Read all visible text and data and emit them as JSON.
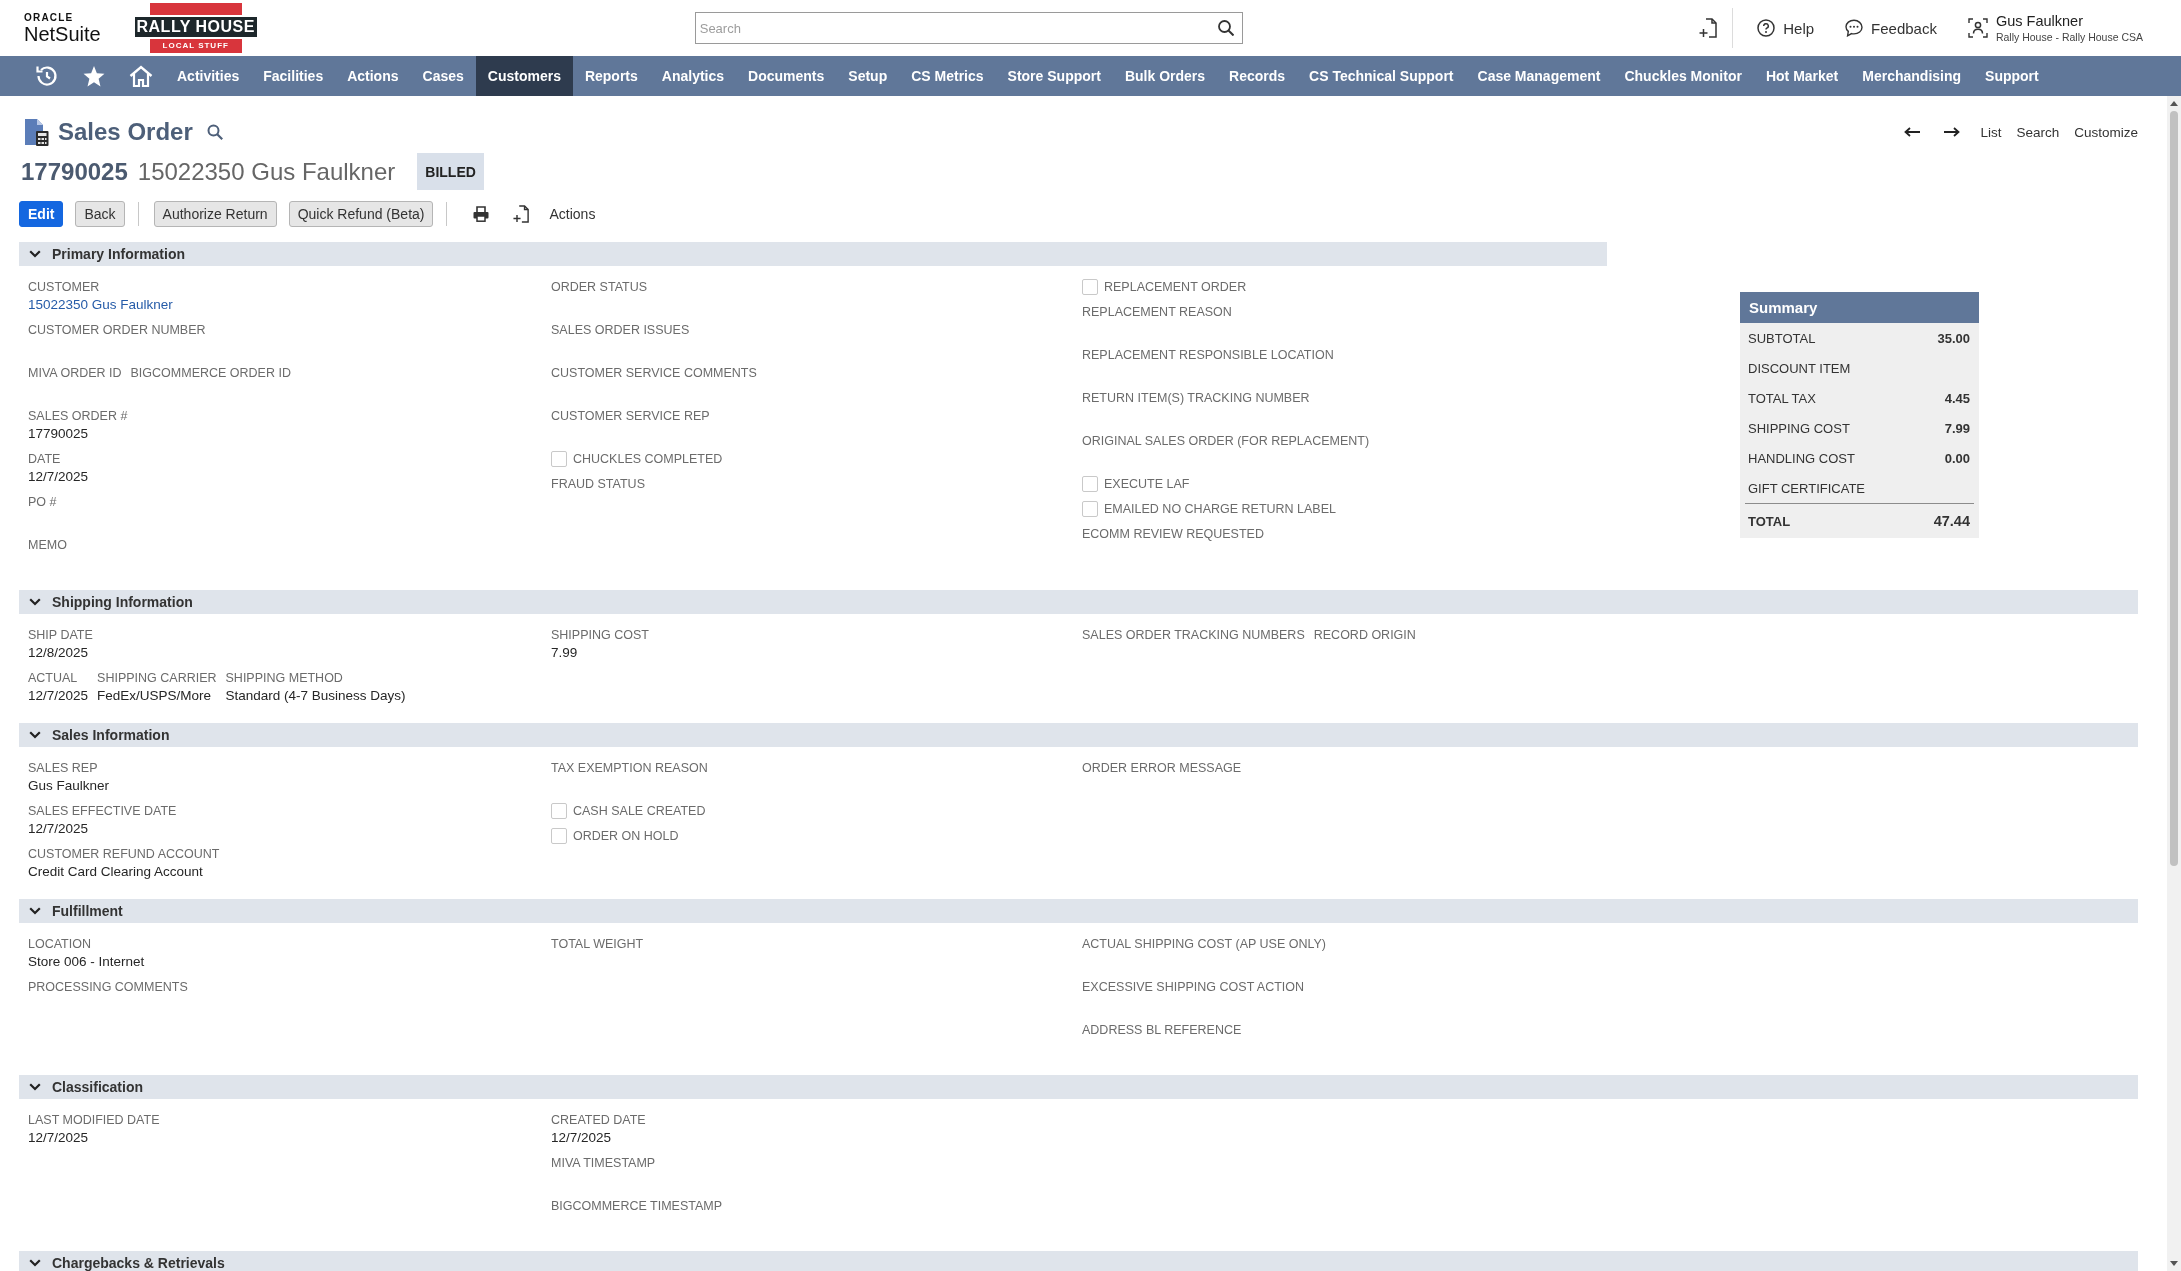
{
  "header": {
    "brand": {
      "vendor": "ORACLE",
      "product": "NetSuite"
    },
    "company_logo": {
      "wordmark": "RALLY HOUSE",
      "tagline": "LOCAL STUFF"
    },
    "search": {
      "placeholder": "Search"
    },
    "links": [
      {
        "kind": "help",
        "label": "Help"
      },
      {
        "kind": "feedback",
        "label": "Feedback"
      }
    ],
    "user": {
      "name": "Gus Faulkner",
      "role": "Rally House - Rally House CSA"
    }
  },
  "nav": {
    "items": [
      {
        "label": "Activities",
        "selected": false
      },
      {
        "label": "Facilities",
        "selected": false
      },
      {
        "label": "Actions",
        "selected": false
      },
      {
        "label": "Cases",
        "selected": false
      },
      {
        "label": "Customers",
        "selected": true
      },
      {
        "label": "Reports",
        "selected": false
      },
      {
        "label": "Analytics",
        "selected": false
      },
      {
        "label": "Documents",
        "selected": false
      },
      {
        "label": "Setup",
        "selected": false
      },
      {
        "label": "CS Metrics",
        "selected": false
      },
      {
        "label": "Store Support",
        "selected": false
      },
      {
        "label": "Bulk Orders",
        "selected": false
      },
      {
        "label": "Records",
        "selected": false
      },
      {
        "label": "CS Technical Support",
        "selected": false
      },
      {
        "label": "Case Management",
        "selected": false
      },
      {
        "label": "Chuckles Monitor",
        "selected": false
      },
      {
        "label": "Hot Market",
        "selected": false
      },
      {
        "label": "Merchandising",
        "selected": false
      },
      {
        "label": "Support",
        "selected": false
      }
    ]
  },
  "record": {
    "type": "Sales Order",
    "number": "17790025",
    "name": "15022350 Gus Faulkner",
    "status": "BILLED"
  },
  "record_nav": {
    "links": [
      "List",
      "Search",
      "Customize"
    ]
  },
  "toolbar": {
    "button_groups": [
      [
        {
          "label": "Edit",
          "primary": true
        },
        {
          "label": "Back",
          "primary": false
        }
      ],
      [
        {
          "label": "Authorize Return",
          "primary": false
        },
        {
          "label": "Quick Refund (Beta)",
          "primary": false
        }
      ]
    ],
    "actions_label": "Actions"
  },
  "sections": [
    {
      "title": "Primary Information",
      "expanded": true,
      "columns": [
        [
          {
            "kind": "link",
            "label": "CUSTOMER",
            "value": "15022350 Gus Faulkner"
          },
          {
            "kind": "field",
            "label": "CUSTOMER ORDER NUMBER"
          },
          {
            "kind": "group",
            "fields": [
              {
                "label": "MIVA ORDER ID"
              },
              {
                "label": "BIGCOMMERCE ORDER ID"
              }
            ]
          },
          {
            "kind": "field",
            "label": "SALES ORDER #",
            "value": "17790025"
          },
          {
            "kind": "field",
            "label": "DATE",
            "value": "12/7/2025"
          },
          {
            "kind": "field",
            "label": "PO #"
          },
          {
            "kind": "field",
            "label": "MEMO"
          }
        ],
        [
          {
            "kind": "field",
            "label": "ORDER STATUS"
          },
          {
            "kind": "field",
            "label": "SALES ORDER ISSUES"
          },
          {
            "kind": "field",
            "label": "CUSTOMER SERVICE COMMENTS"
          },
          {
            "kind": "field",
            "label": "CUSTOMER SERVICE REP"
          },
          {
            "kind": "checkbox",
            "label": "CHUCKLES COMPLETED",
            "checked": false
          },
          {
            "kind": "field",
            "label": "FRAUD STATUS"
          }
        ],
        [
          {
            "kind": "checkbox",
            "label": "REPLACEMENT ORDER",
            "checked": false
          },
          {
            "kind": "field",
            "label": "REPLACEMENT REASON"
          },
          {
            "kind": "field",
            "label": "REPLACEMENT RESPONSIBLE LOCATION"
          },
          {
            "kind": "field",
            "label": "RETURN ITEM(S) TRACKING NUMBER"
          },
          {
            "kind": "field",
            "label": "ORIGINAL SALES ORDER (FOR REPLACEMENT)"
          },
          {
            "kind": "checkbox",
            "label": "EXECUTE LAF",
            "checked": false
          },
          {
            "kind": "checkbox",
            "label": "EMAILED NO CHARGE RETURN LABEL",
            "checked": false
          },
          {
            "kind": "field",
            "label": "ECOMM REVIEW REQUESTED"
          }
        ]
      ],
      "summary": {
        "title": "Summary",
        "rows": [
          {
            "label": "SUBTOTAL",
            "value": "35.00"
          },
          {
            "label": "DISCOUNT ITEM"
          },
          {
            "label": "TOTAL TAX",
            "value": "4.45"
          },
          {
            "label": "SHIPPING COST",
            "value": "7.99"
          },
          {
            "label": "HANDLING COST",
            "value": "0.00"
          },
          {
            "label": "GIFT CERTIFICATE"
          }
        ],
        "total": {
          "label": "TOTAL",
          "value": "47.44"
        }
      }
    },
    {
      "title": "Shipping Information",
      "expanded": true,
      "columns": [
        [
          {
            "kind": "field",
            "label": "SHIP DATE",
            "value": "12/8/2025"
          },
          {
            "kind": "group",
            "fields": [
              {
                "label": "ACTUAL",
                "value": "12/7/2025"
              },
              {
                "label": "SHIPPING CARRIER",
                "value": "FedEx/USPS/More"
              },
              {
                "label": "SHIPPING METHOD",
                "value": "Standard (4-7 Business Days)"
              }
            ]
          }
        ],
        [
          {
            "kind": "field",
            "label": "SHIPPING COST",
            "value": "7.99"
          }
        ],
        [
          {
            "kind": "group",
            "fields": [
              {
                "label": "SALES ORDER TRACKING NUMBERS"
              },
              {
                "label": "RECORD ORIGIN"
              }
            ]
          }
        ]
      ]
    },
    {
      "title": "Sales Information",
      "expanded": true,
      "columns": [
        [
          {
            "kind": "field",
            "label": "SALES REP",
            "value": "Gus Faulkner"
          },
          {
            "kind": "field",
            "label": "SALES EFFECTIVE DATE",
            "value": "12/7/2025"
          },
          {
            "kind": "field",
            "label": "CUSTOMER REFUND ACCOUNT",
            "value": "Credit Card Clearing Account"
          }
        ],
        [
          {
            "kind": "field",
            "label": "TAX EXEMPTION REASON"
          },
          {
            "kind": "checkbox",
            "label": "CASH SALE CREATED",
            "checked": false
          },
          {
            "kind": "checkbox",
            "label": "ORDER ON HOLD",
            "checked": false
          }
        ],
        [
          {
            "kind": "field",
            "label": "ORDER ERROR MESSAGE"
          }
        ]
      ]
    },
    {
      "title": "Fulfillment",
      "expanded": true,
      "columns": [
        [
          {
            "kind": "field",
            "label": "LOCATION",
            "value": "Store 006 - Internet"
          },
          {
            "kind": "field",
            "label": "PROCESSING COMMENTS"
          }
        ],
        [
          {
            "kind": "field",
            "label": "TOTAL WEIGHT"
          }
        ],
        [
          {
            "kind": "field",
            "label": "ACTUAL SHIPPING COST (AP USE ONLY)"
          },
          {
            "kind": "field",
            "label": "EXCESSIVE SHIPPING COST ACTION"
          },
          {
            "kind": "field",
            "label": "ADDRESS BL REFERENCE"
          }
        ]
      ]
    },
    {
      "title": "Classification",
      "expanded": true,
      "columns": [
        [
          {
            "kind": "field",
            "label": "LAST MODIFIED DATE",
            "value": "12/7/2025"
          }
        ],
        [
          {
            "kind": "field",
            "label": "CREATED DATE",
            "value": "12/7/2025"
          },
          {
            "kind": "field",
            "label": "MIVA TIMESTAMP"
          },
          {
            "kind": "field",
            "label": "BIGCOMMERCE TIMESTAMP"
          }
        ]
      ]
    },
    {
      "title": "Chargebacks & Retrievals",
      "expanded": true
    }
  ]
}
